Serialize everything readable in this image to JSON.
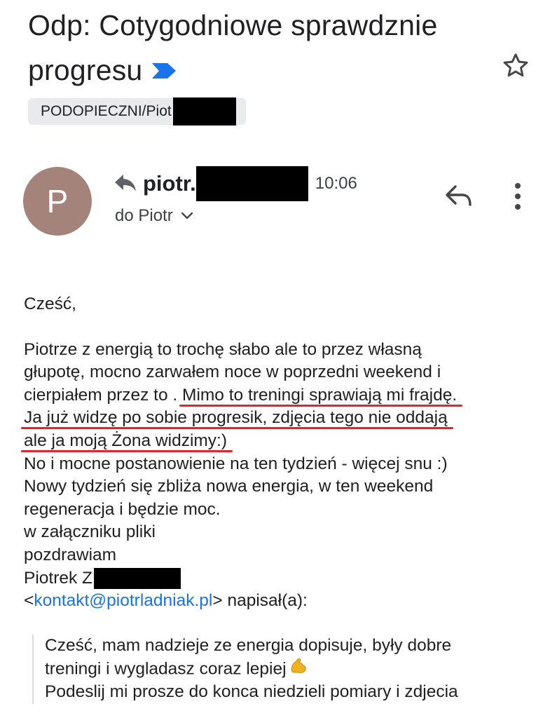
{
  "email": {
    "subject": "Odp: Cotygodniowe sprawdznie progresu",
    "label": "PODOPIECZNI/Piot",
    "sender": {
      "avatar_letter": "P",
      "name": "piotr.",
      "time": "10:06",
      "recipient": "do Piotr"
    },
    "body": {
      "greeting": "Cześć,",
      "p1_a": "Piotrze z energią to trochę słabo ale to przez własną",
      "p1_b": "głupotę, mocno zarwałem noce w poprzedni weekend i",
      "p1_c": "cierpiałem przez to . ",
      "p1_c_ul": "Mimo to treningi sprawiają mi frajdę.",
      "p1_d_ul": "Ja już widzę po sobie progresik, zdjęcia tego nie oddają",
      "p1_e_ul": "ale ja moją Żona widzimy:)",
      "p2": "No i mocne postanowienie na ten tydzień - więcej snu :)",
      "p3_a": "Nowy tydzień się zbliża nowa energia, w ten weekend",
      "p3_b": "regeneracja i będzie moc.",
      "p4": "w załączniku pliki",
      "p5": "pozdrawiam",
      "signature": "Piotrek Z"
    },
    "quote_header": {
      "prefix": "<",
      "email": "kontakt@piotrladniak.pl",
      "suffix": "> napisał(a):"
    },
    "quoted": {
      "line1": "Cześć, mam nadzieje ze energia dopisuje, były dobre",
      "line2": "treningi i wygladasz coraz lepiej",
      "line3": "Podeslij mi prosze do konca niedzieli pomiary i zdjecia"
    }
  },
  "colors": {
    "avatar_bg": "#a3837a",
    "importance_marker": "#1a73e8",
    "link": "#1a73e8",
    "underline": "#e0252b"
  },
  "icons": [
    "importance-marker-icon",
    "star-icon",
    "reply-arrow-icon",
    "chevron-down-icon",
    "reply-icon",
    "more-vert-icon",
    "flexed-biceps-icon"
  ]
}
